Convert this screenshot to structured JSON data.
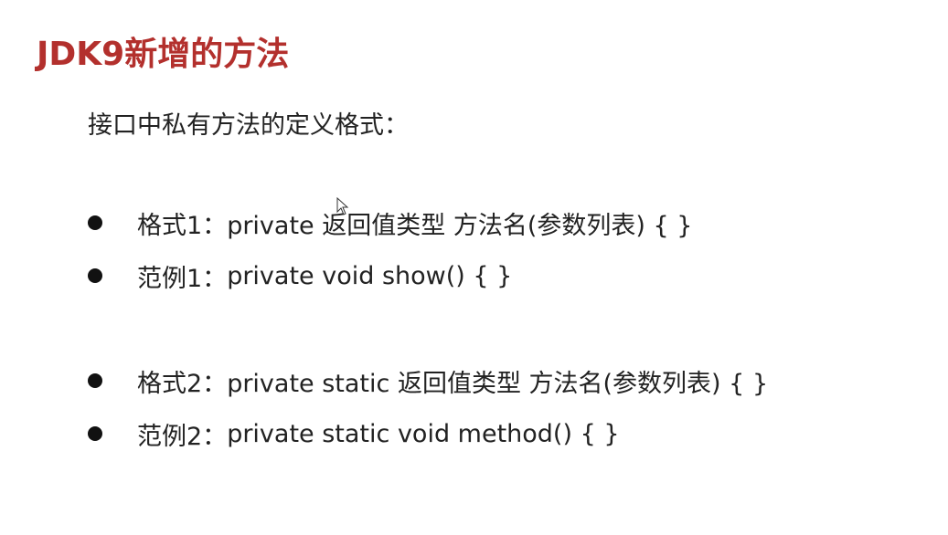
{
  "slide": {
    "title": "JDK9新增的方法",
    "intro": "接口中私有方法的定义格式：",
    "items": [
      {
        "label": "格式1：",
        "text": "private 返回值类型 方法名(参数列表) {   }"
      },
      {
        "label": "范例1：",
        "text": "private void show() {   }"
      },
      {
        "label": "格式2：",
        "text": "private static 返回值类型 方法名(参数列表) {   }"
      },
      {
        "label": "范例2：",
        "text": "private static void method() {   }"
      }
    ]
  },
  "colors": {
    "title": "#b3302d",
    "text": "#222222",
    "bullet": "#111111"
  },
  "icons": {
    "cursor": "mouse-pointer-icon"
  }
}
